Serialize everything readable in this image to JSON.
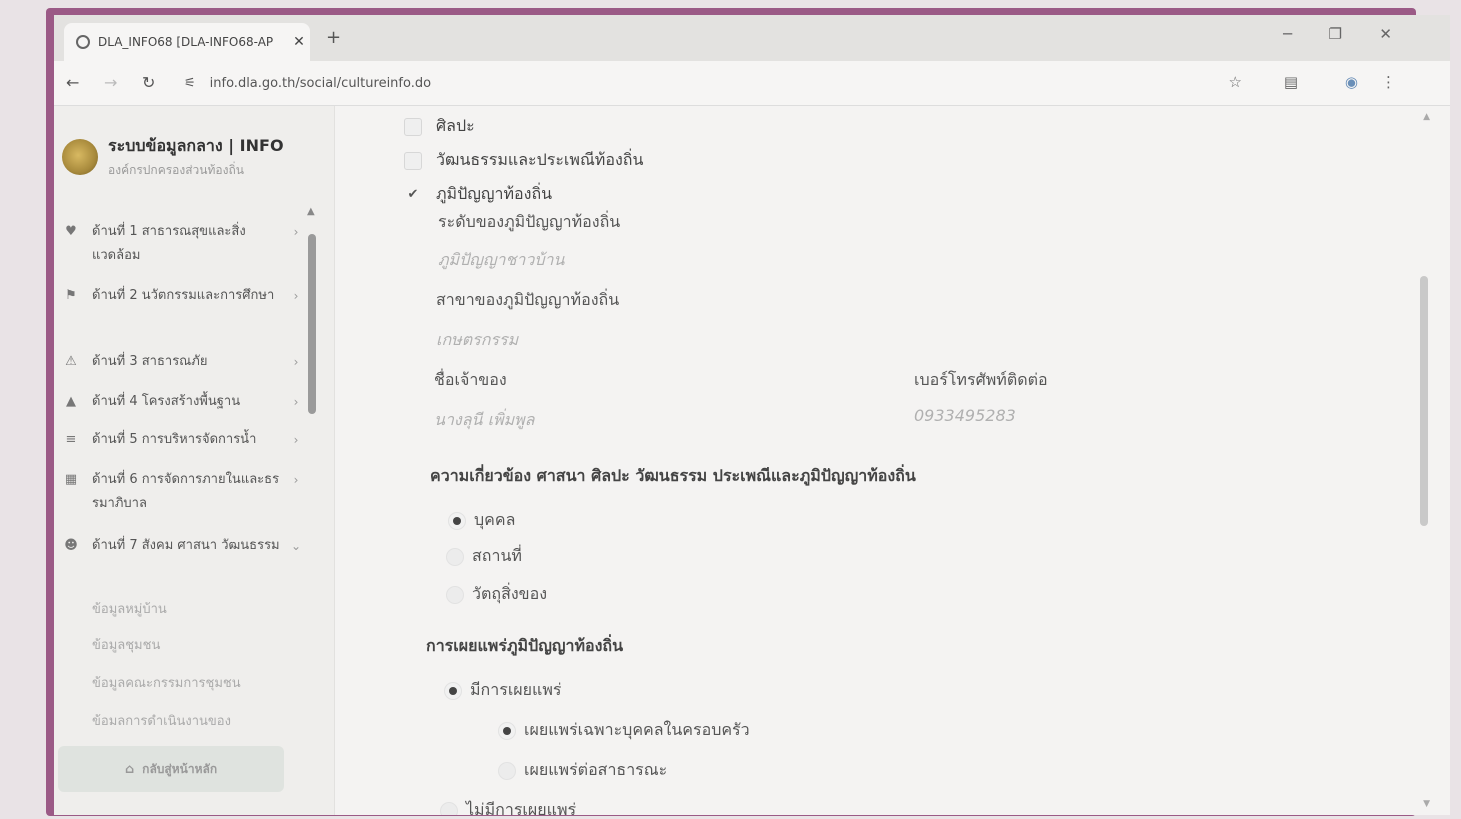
{
  "browser": {
    "tab_title": "DLA_INFO68 [DLA-INFO68-AP",
    "tab_close": "✕",
    "new_tab": "+",
    "url": "info.dla.go.th/social/cultureinfo.do",
    "win_min": "─",
    "win_restore": "❐",
    "win_close": "✕"
  },
  "sidebar": {
    "brand_title": "ระบบข้อมูลกลาง | INFO",
    "brand_subtitle": "องค์กรปกครองส่วนท้องถิ่น",
    "items": [
      {
        "label": "ด้านที่ 1 สาธารณสุขและสิ่งแวดล้อม",
        "icon": "heart-icon"
      },
      {
        "label": "ด้านที่ 2 นวัตกรรมและการศึกษา",
        "icon": "education-icon"
      },
      {
        "label": "ด้านที่ 3 สาธารณภัย",
        "icon": "disaster-icon"
      },
      {
        "label": "ด้านที่ 4 โครงสร้างพื้นฐาน",
        "icon": "road-icon"
      },
      {
        "label": "ด้านที่ 5 การบริหารจัดการน้ำ",
        "icon": "water-icon"
      },
      {
        "label": "ด้านที่ 6 การจัดการภายในและธรรมาภิบาล",
        "icon": "building-icon"
      },
      {
        "label": "ด้านที่ 7 สังคม ศาสนา วัฒนธรรม",
        "icon": "people-icon"
      }
    ],
    "sub_items": [
      "ข้อมูลหมู่บ้าน",
      "ข้อมูลชุมชน",
      "ข้อมูลคณะกรรมการชุมชน",
      "ข้อมลการดำเนินงานของ"
    ],
    "home_button": "กลับสู่หน้าหลัก"
  },
  "content": {
    "checkboxes": [
      {
        "label": "ศิลปะ",
        "checked": false
      },
      {
        "label": "วัฒนธรรมและประเพณีท้องถิ่น",
        "checked": false
      },
      {
        "label": "ภูมิปัญญาท้องถิ่น",
        "checked": true
      }
    ],
    "wisdom_level_label": "ระดับของภูมิปัญญาท้องถิ่น",
    "wisdom_level_value": "ภูมิปัญญาชาวบ้าน",
    "wisdom_branch_label": "สาขาของภูมิปัญญาท้องถิ่น",
    "wisdom_branch_value": "เกษตรกรรม",
    "owner_label": "ชื่อเจ้าของ",
    "owner_value": "นางลุนี เพิ่มพูล",
    "phone_label": "เบอร์โทรศัพท์ติดต่อ",
    "phone_value": "0933495283",
    "relation_title": "ความเกี่ยวข้อง ศาสนา ศิลปะ วัฒนธรรม ประเพณีและภูมิปัญญาท้องถิ่น",
    "relation_options": [
      {
        "label": "บุคคล",
        "selected": true
      },
      {
        "label": "สถานที่",
        "selected": false
      },
      {
        "label": "วัตถุสิ่งของ",
        "selected": false
      }
    ],
    "dissemination_title": "การเผยแพร่ภูมิปัญญาท้องถิ่น",
    "dissemination_yes": "มีการเผยแพร่",
    "dissemination_sub": [
      {
        "label": "เผยแพร่เฉพาะบุคคลในครอบครัว",
        "selected": true
      },
      {
        "label": "เผยแพร่ต่อสาธารณะ",
        "selected": false
      }
    ],
    "dissemination_no": "ไม่มีการเผยแพร่"
  }
}
